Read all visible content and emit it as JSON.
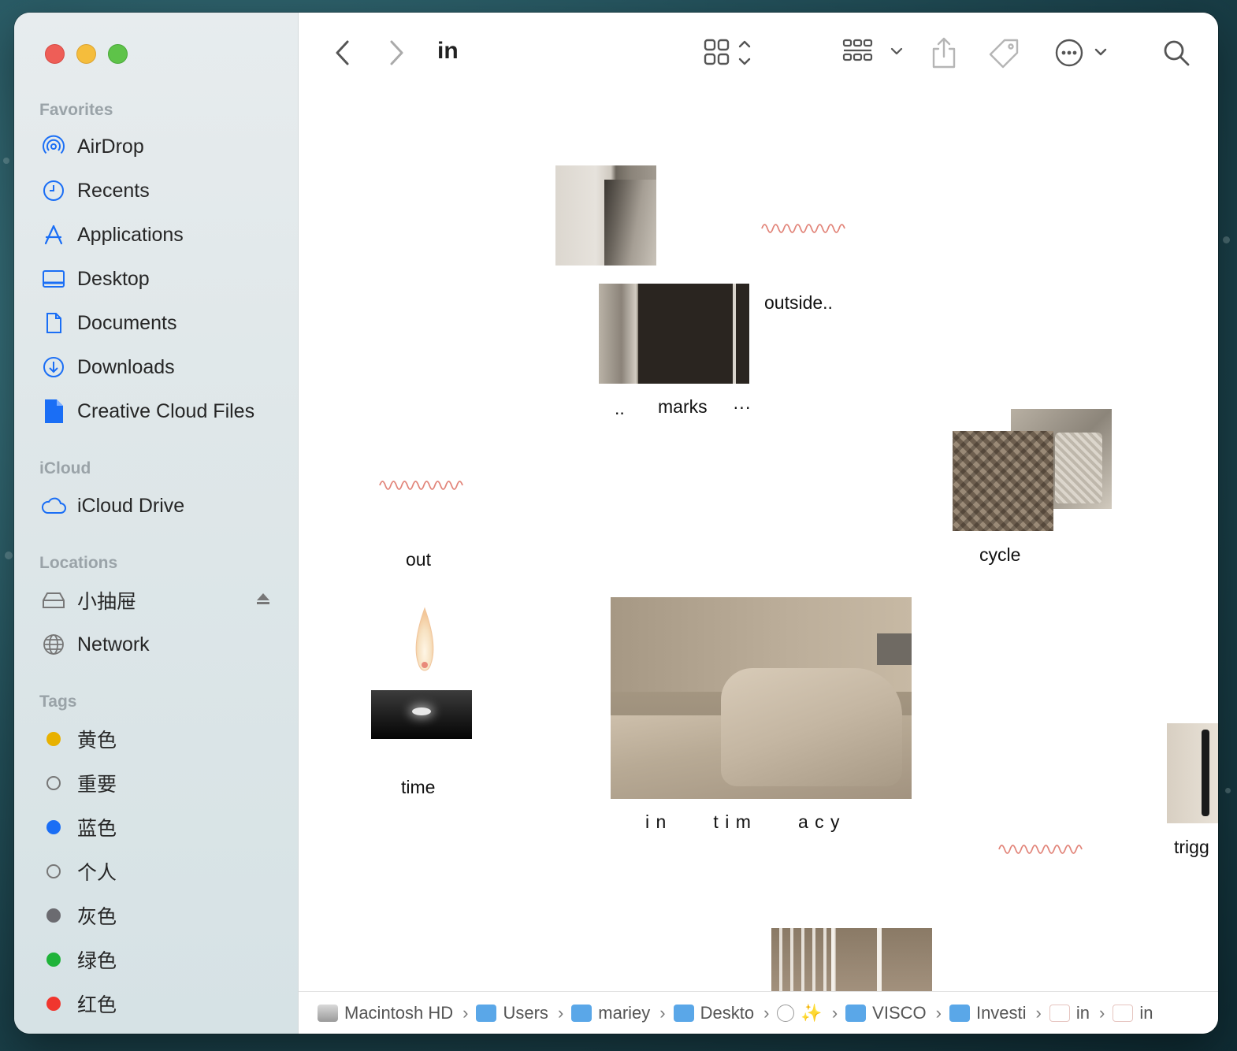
{
  "window": {
    "title": "in"
  },
  "sidebar": {
    "favorites_title": "Favorites",
    "favorites": [
      {
        "label": "AirDrop",
        "icon": "airdrop-icon"
      },
      {
        "label": "Recents",
        "icon": "clock-icon"
      },
      {
        "label": "Applications",
        "icon": "applications-icon"
      },
      {
        "label": "Desktop",
        "icon": "desktop-icon"
      },
      {
        "label": "Documents",
        "icon": "document-icon"
      },
      {
        "label": "Downloads",
        "icon": "download-icon"
      },
      {
        "label": "Creative Cloud Files",
        "icon": "file-icon"
      }
    ],
    "icloud_title": "iCloud",
    "icloud": [
      {
        "label": "iCloud Drive",
        "icon": "cloud-icon"
      }
    ],
    "locations_title": "Locations",
    "locations": [
      {
        "label": "小抽屉",
        "icon": "drive-icon"
      },
      {
        "label": "Network",
        "icon": "globe-icon"
      }
    ],
    "tags_title": "Tags",
    "tags": [
      {
        "label": "黄色",
        "color": "#e8b100",
        "filled": true
      },
      {
        "label": "重要",
        "color": "#777777",
        "filled": false
      },
      {
        "label": "蓝色",
        "color": "#1a6ef5",
        "filled": true
      },
      {
        "label": "个人",
        "color": "#777777",
        "filled": false
      },
      {
        "label": "灰色",
        "color": "#6b6b70",
        "filled": true
      },
      {
        "label": "绿色",
        "color": "#1fb33a",
        "filled": true
      },
      {
        "label": "红色",
        "color": "#f0362e",
        "filled": true
      }
    ]
  },
  "content": {
    "labels": {
      "outside": "outside..",
      "dots_left": "..",
      "marks": "marks",
      "dots_right": "···",
      "out": "out",
      "cycle": "cycle",
      "time": "time",
      "intimacy": "i n        t i m        a c y",
      "trigger": "trigg"
    }
  },
  "pathbar": {
    "crumbs": [
      {
        "label": "Macintosh HD",
        "icon": "hard-drive-icon"
      },
      {
        "label": "Users",
        "icon": "folder-icon"
      },
      {
        "label": "mariey",
        "icon": "home-folder-icon"
      },
      {
        "label": "Deskto",
        "icon": "desktop-folder-icon"
      },
      {
        "label": "✨",
        "icon": "moon-icon"
      },
      {
        "label": "VISCO",
        "icon": "folder-icon"
      },
      {
        "label": "Investi",
        "icon": "folder-icon"
      },
      {
        "label": "in",
        "icon": "package-icon"
      },
      {
        "label": "in",
        "icon": "package-icon"
      }
    ]
  },
  "colors": {
    "accent": "#1a6ef5",
    "squiggle": "#e2857a"
  }
}
